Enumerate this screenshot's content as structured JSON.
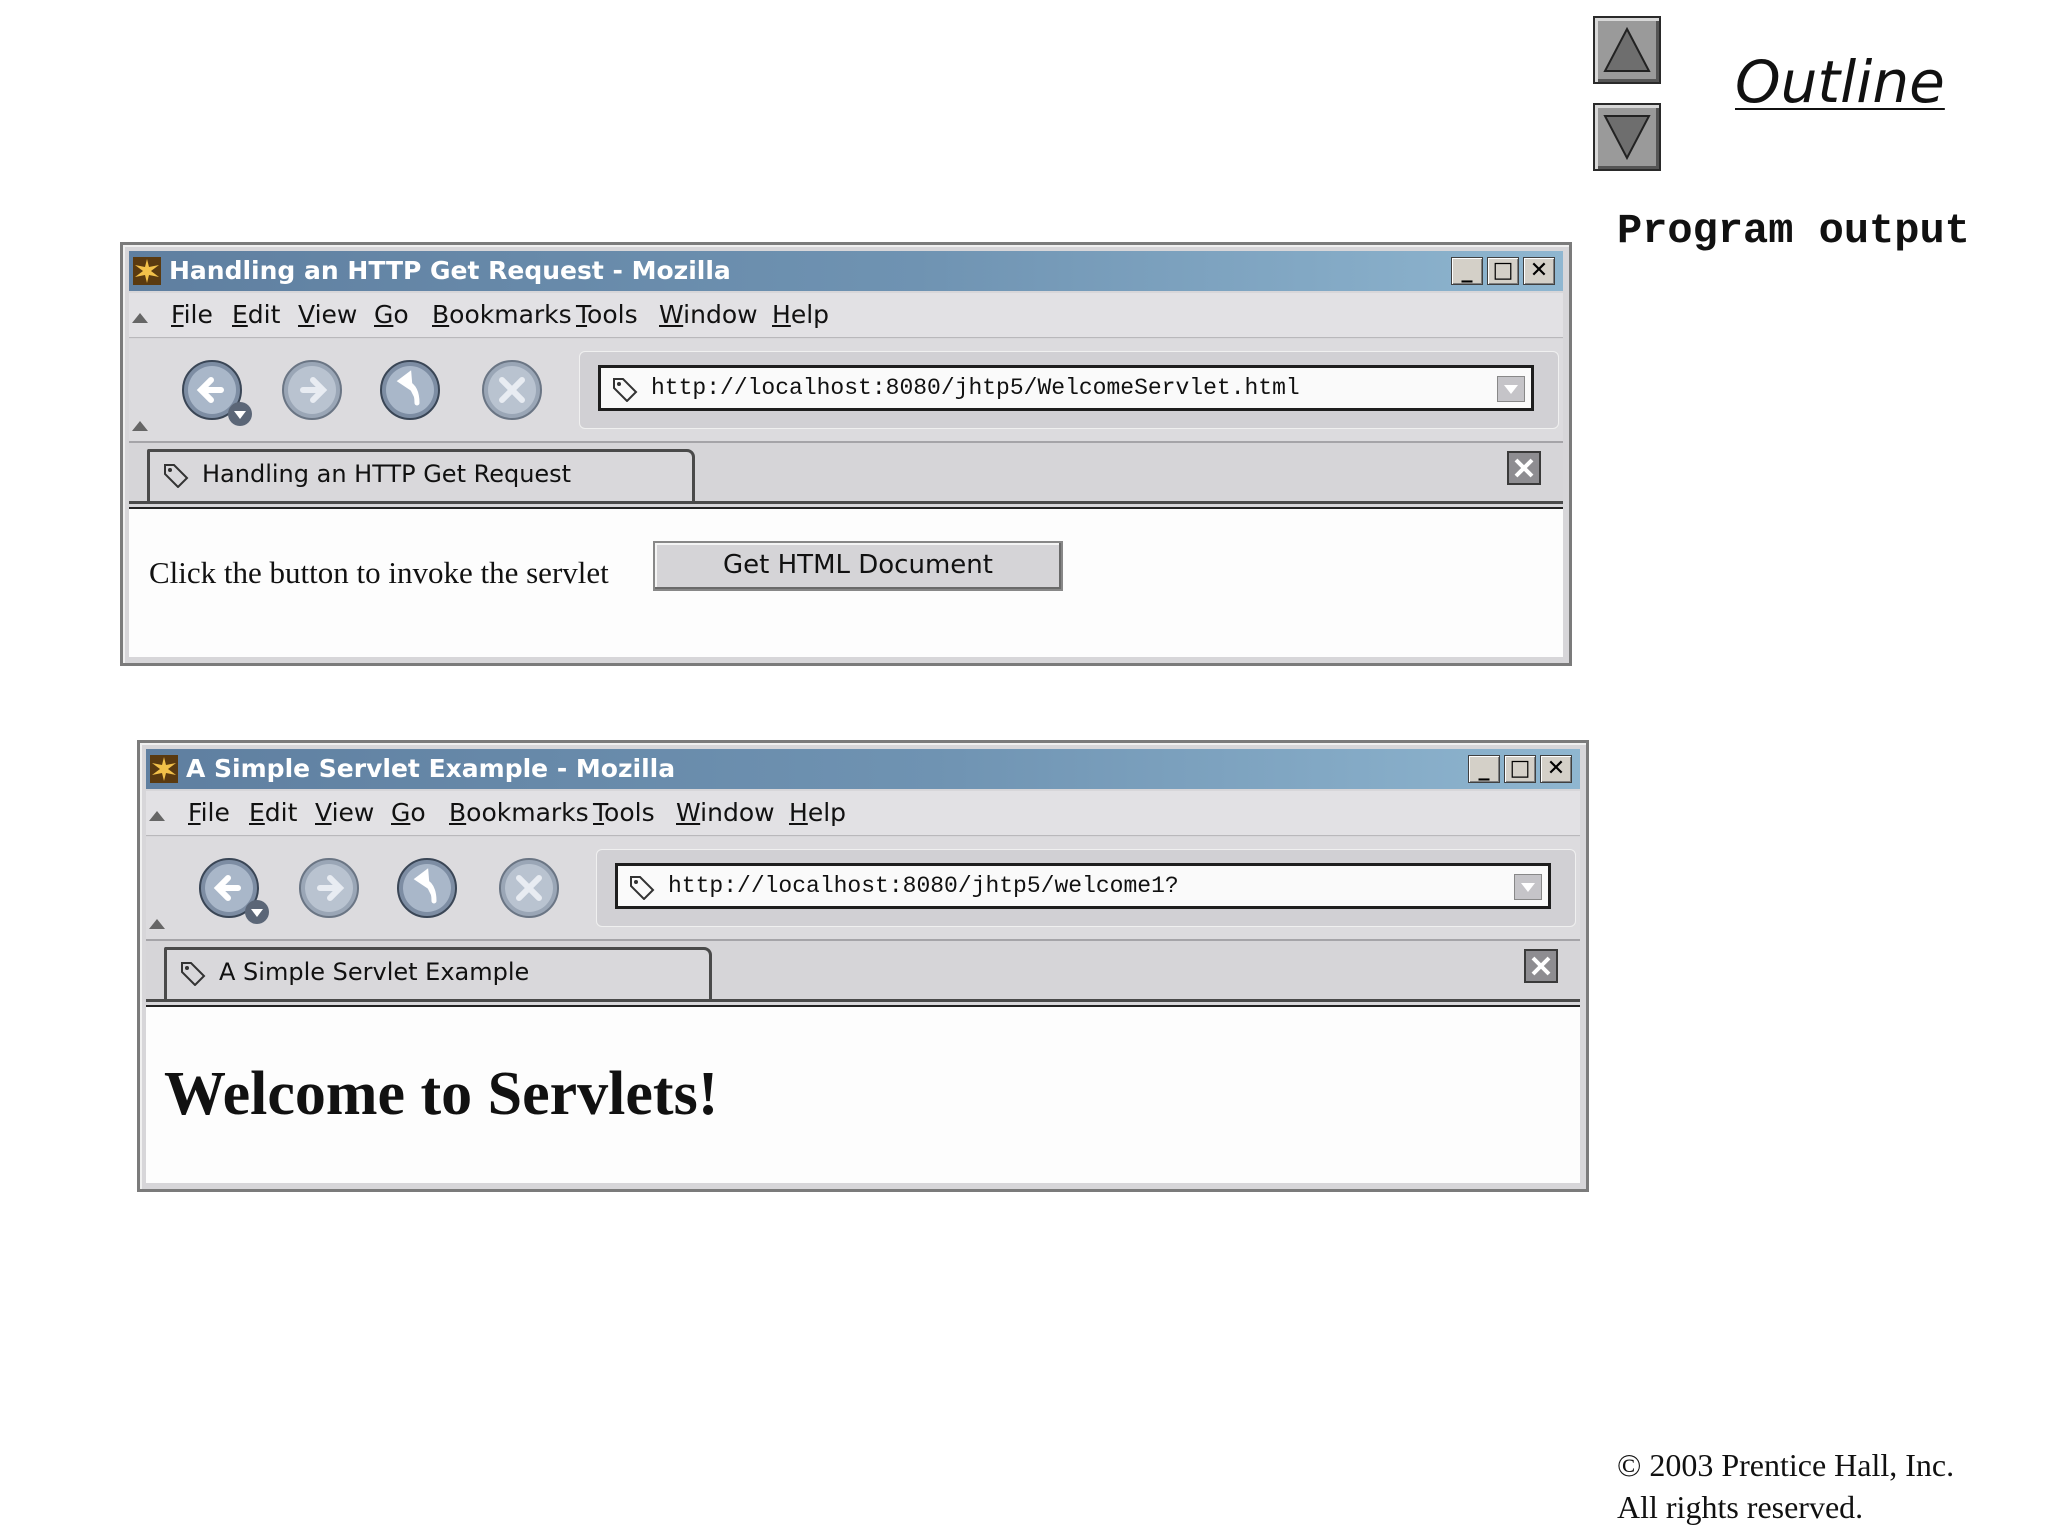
{
  "slide": {
    "outline_label": "Outline",
    "program_output_label": "Program output",
    "copyright_line1": "© 2003 Prentice Hall, Inc.",
    "copyright_line2": "All rights reserved."
  },
  "windows": [
    {
      "title": "Handling an HTTP Get Request - Mozilla",
      "menu": [
        "File",
        "Edit",
        "View",
        "Go",
        "Bookmarks",
        "Tools",
        "Window",
        "Help"
      ],
      "url": "http://localhost:8080/jhtp5/WelcomeServlet.html",
      "tab_label": "Handling an HTTP Get Request",
      "content_text": "Click the button to invoke the servlet",
      "button_label": "Get HTML Document"
    },
    {
      "title": "A Simple Servlet Example - Mozilla",
      "menu": [
        "File",
        "Edit",
        "View",
        "Go",
        "Bookmarks",
        "Tools",
        "Window",
        "Help"
      ],
      "url": "http://localhost:8080/jhtp5/welcome1?",
      "tab_label": "A Simple Servlet Example",
      "heading": "Welcome to Servlets!"
    }
  ],
  "window_buttons": {
    "minimize": "_",
    "maximize": "□",
    "close": "✕"
  },
  "icons": {
    "nav_up": "triangle-up-icon",
    "nav_down": "triangle-down-icon",
    "back": "back-arrow-icon",
    "forward": "forward-arrow-icon",
    "reload": "reload-icon",
    "stop": "stop-icon",
    "page": "page-tag-icon",
    "tab_close": "close-icon",
    "app": "mozilla-app-icon"
  },
  "colors": {
    "titlebar_start": "#5f7fa0",
    "titlebar_end": "#8fb6d0",
    "nav_button": "#9a9a9a",
    "chrome_bg": "#d7d6d9"
  }
}
